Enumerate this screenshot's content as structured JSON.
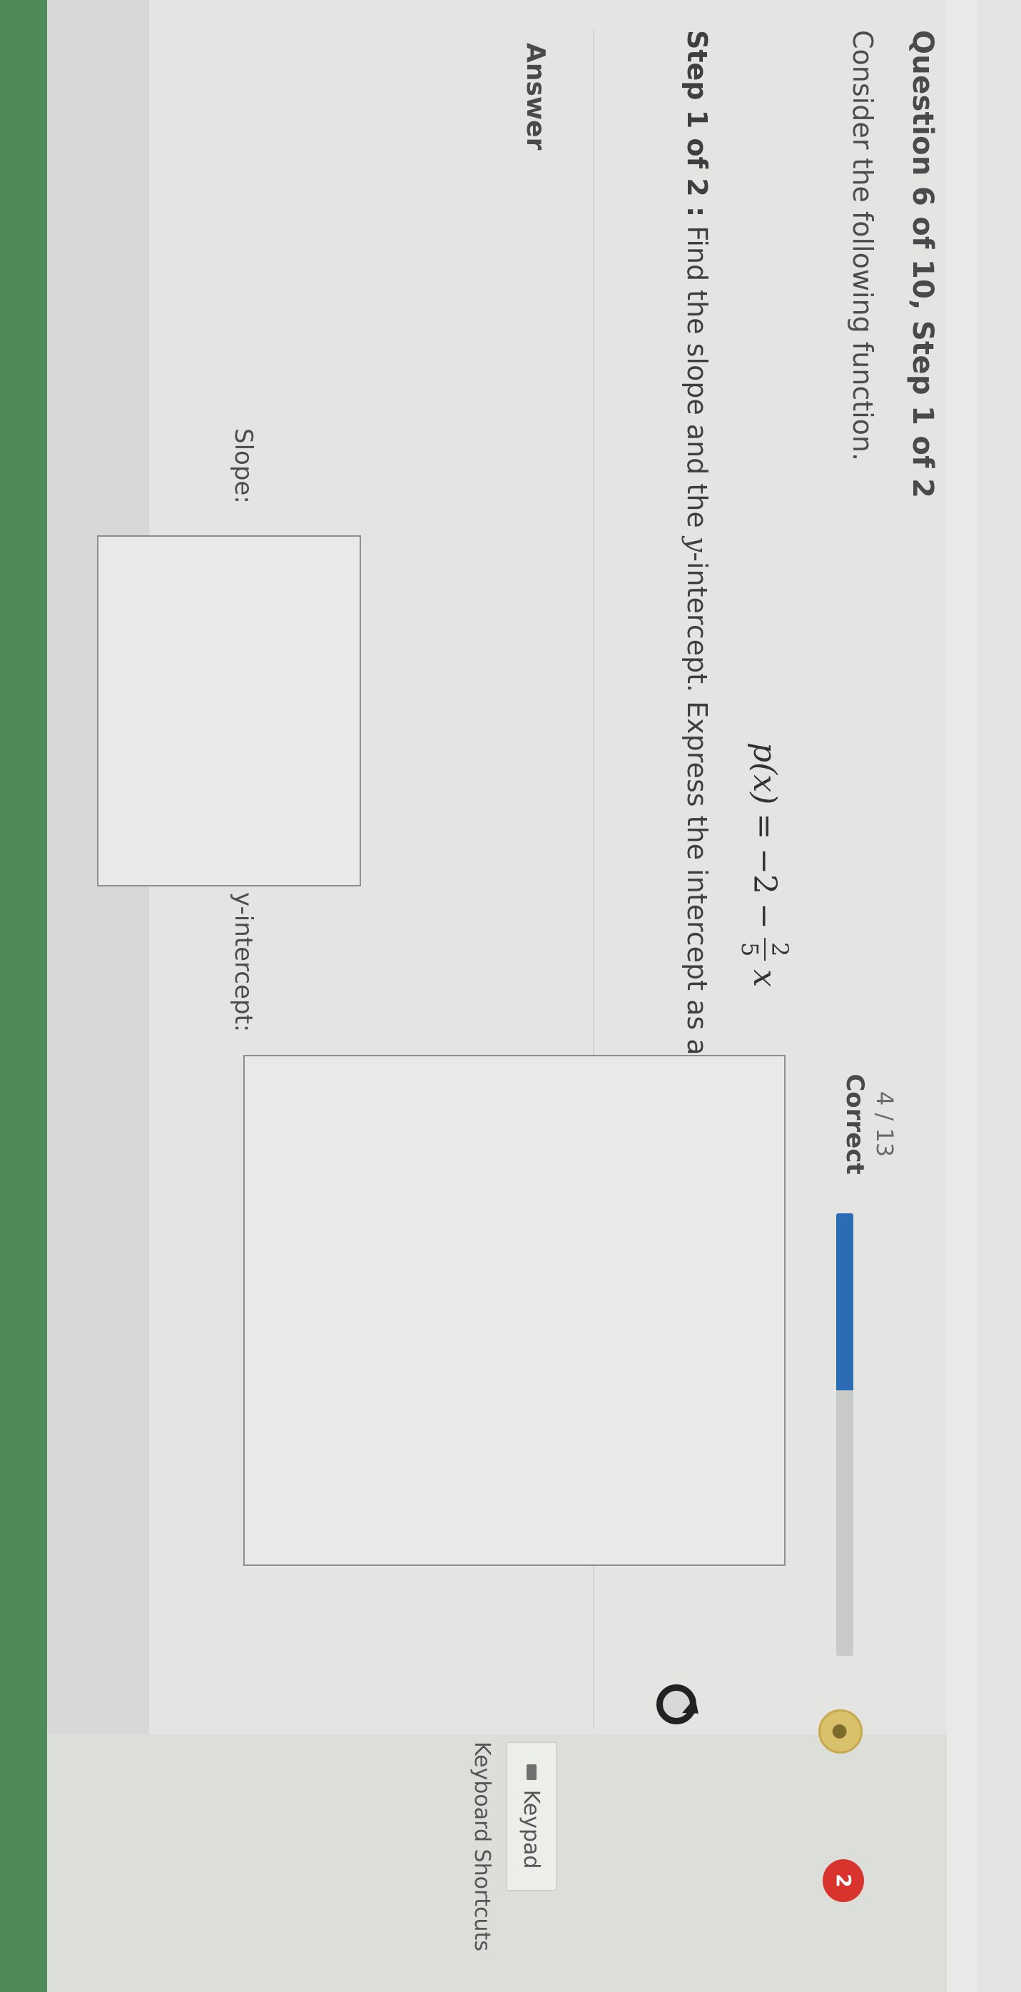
{
  "header": {
    "question_title": "Question 6 of 10, Step 1 of 2",
    "score": "4 / 13",
    "score_label": "Correct",
    "progress_fraction": 0.4,
    "hearts": "2"
  },
  "problem": {
    "prompt": "Consider the following function.",
    "function_name": "p(x)",
    "equals": "=",
    "constant": "−2",
    "minus": "−",
    "fraction_numerator": "2",
    "fraction_denominator": "5",
    "variable": "x",
    "step_label": "Step 1 of 2 :",
    "step_text_before": "Find the slope and the ",
    "step_text_italic": "y",
    "step_text_after": "-intercept.  Express the intercept as an ordered pair.  Simplify your answer."
  },
  "answer": {
    "heading": "Answer",
    "slope_label": "Slope:",
    "yint_label": "y-intercept:",
    "slope_value": "",
    "yint_value": ""
  },
  "tools": {
    "keypad_label": "Keypad",
    "shortcuts_label": "Keyboard Shortcuts"
  },
  "colors": {
    "progress": "#2c6cb5",
    "heart": "#d8342d",
    "accent_green": "#4e8a5a"
  }
}
